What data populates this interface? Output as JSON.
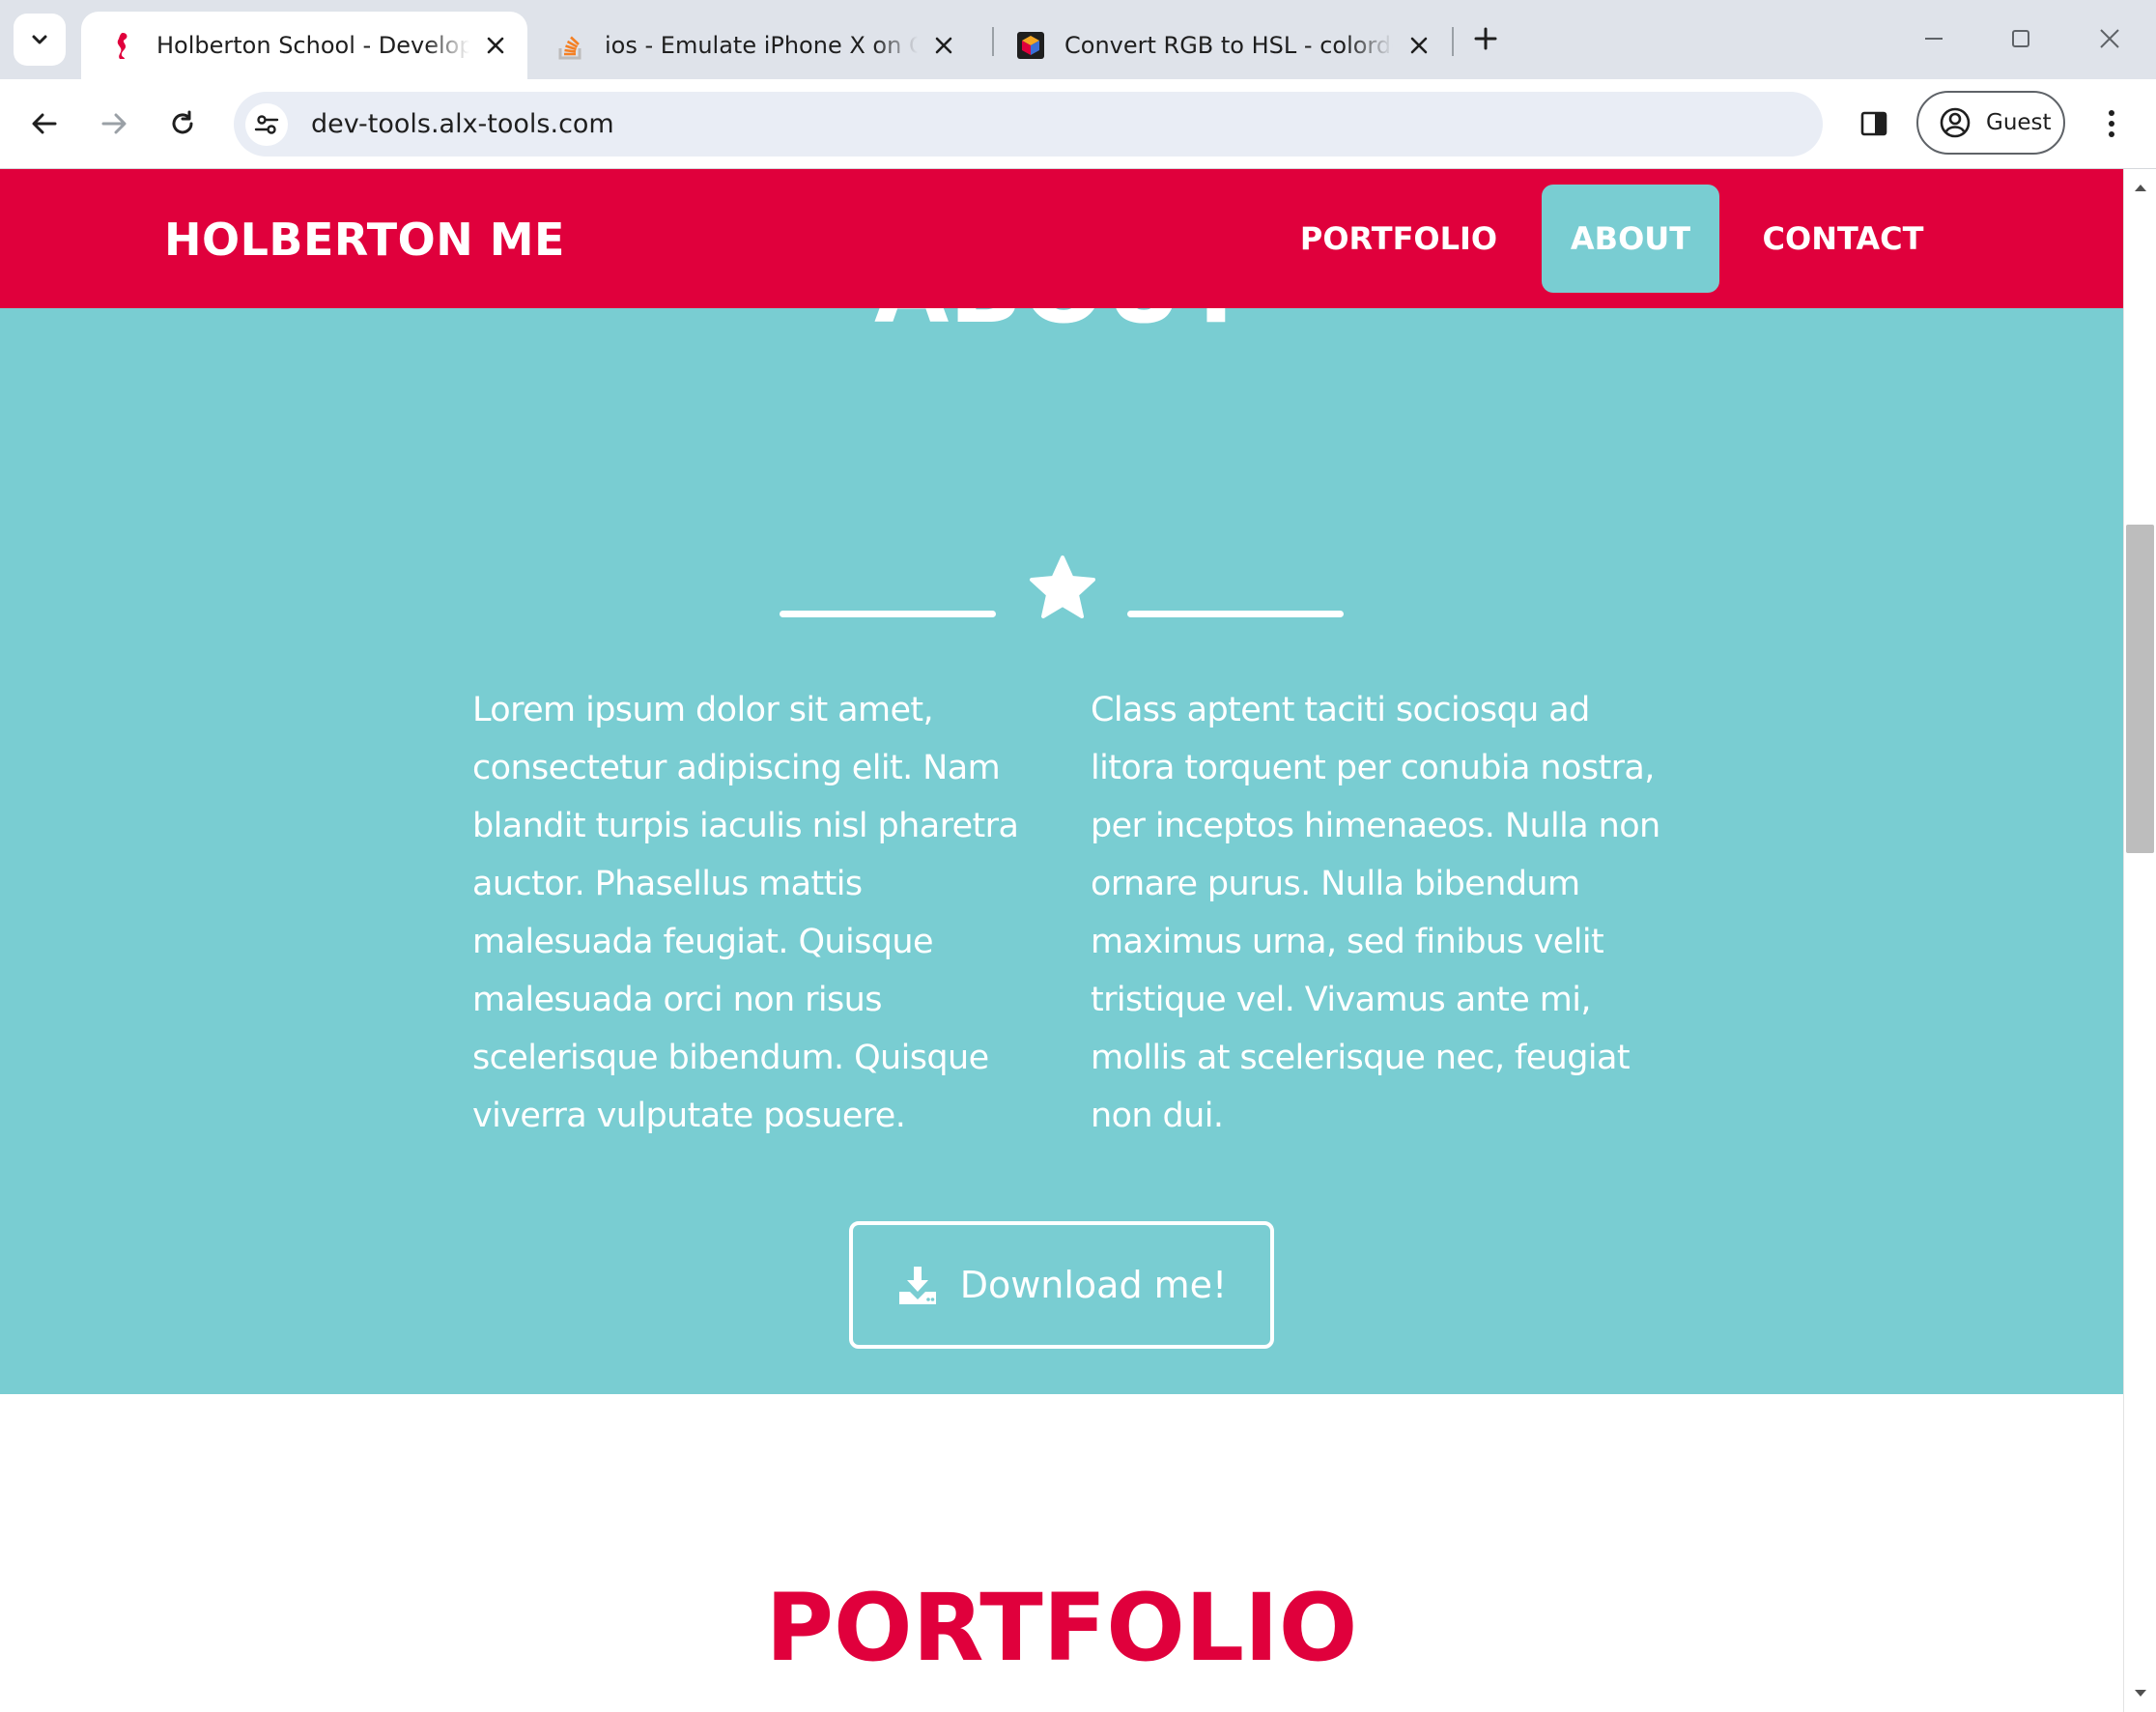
{
  "browser": {
    "tabs": [
      {
        "title": "Holberton School - Developer tools",
        "icon": "holberton-seahorse-icon",
        "active": true
      },
      {
        "title": "ios - Emulate iPhone X on Chrome",
        "icon": "stackoverflow-icon",
        "active": false
      },
      {
        "title": "Convert RGB to HSL - colordesigner",
        "icon": "colordesigner-icon",
        "active": false
      }
    ],
    "url": "dev-tools.alx-tools.com",
    "profile_label": "Guest"
  },
  "site": {
    "brand": "HOLBERTON ME",
    "nav": [
      {
        "label": "PORTFOLIO",
        "active": false
      },
      {
        "label": "ABOUT",
        "active": true
      },
      {
        "label": "CONTACT",
        "active": false
      }
    ],
    "about": {
      "heading": "ABOUT",
      "col1": "Lorem ipsum dolor sit amet, consectetur adipiscing elit. Nam blandit turpis iaculis nisl pharetra auctor. Phasellus mattis malesuada feugiat. Quisque malesuada orci non risus scelerisque bibendum. Quisque viverra vulputate posuere.",
      "col2": "Class aptent taciti sociosqu ad litora torquent per conubia nostra, per inceptos himenaeos. Nulla non ornare purus. Nulla bibendum maximus urna, sed finibus velit tristique vel. Vivamus ante mi, mollis at scelerisque nec, feugiat non dui.",
      "button_label": "Download me!"
    },
    "portfolio_heading": "PORTFOLIO"
  },
  "colors": {
    "primary_red": "#e0003c",
    "teal": "#79cdd2",
    "white": "#ffffff"
  }
}
